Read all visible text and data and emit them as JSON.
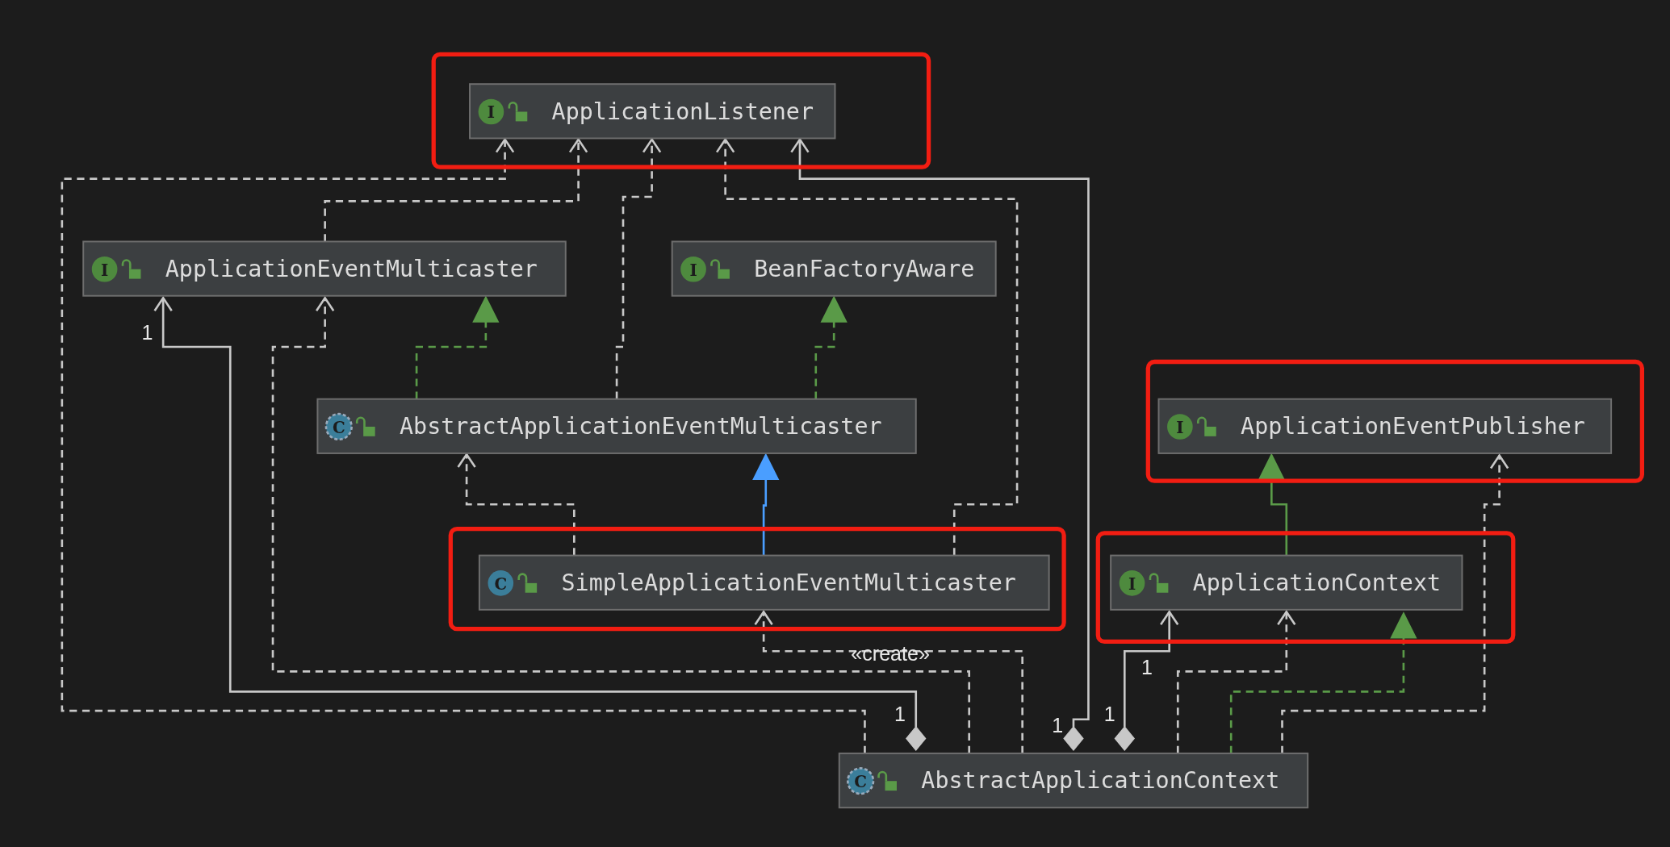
{
  "diagram": {
    "nodes": [
      {
        "name": "ApplicationListener",
        "kind": "interface",
        "badge": "I",
        "highlighted": true
      },
      {
        "name": "ApplicationEventMulticaster",
        "kind": "interface",
        "badge": "I",
        "highlighted": false
      },
      {
        "name": "BeanFactoryAware",
        "kind": "interface",
        "badge": "I",
        "highlighted": false
      },
      {
        "name": "AbstractApplicationEventMulticaster",
        "kind": "abstract",
        "badge": "C",
        "highlighted": false
      },
      {
        "name": "ApplicationEventPublisher",
        "kind": "interface",
        "badge": "I",
        "highlighted": true
      },
      {
        "name": "SimpleApplicationEventMulticaster",
        "kind": "class",
        "badge": "C",
        "highlighted": true
      },
      {
        "name": "ApplicationContext",
        "kind": "interface",
        "badge": "I",
        "highlighted": true
      },
      {
        "name": "AbstractApplicationContext",
        "kind": "abstract",
        "badge": "C",
        "highlighted": false
      }
    ],
    "edges": [
      {
        "kind": "dependency"
      },
      {
        "kind": "dependency"
      },
      {
        "kind": "dependency"
      },
      {
        "kind": "dependency"
      },
      {
        "kind": "composition",
        "labels": [
          "1"
        ]
      },
      {
        "kind": "realization"
      },
      {
        "kind": "realization"
      },
      {
        "kind": "generalization"
      },
      {
        "kind": "dependency"
      },
      {
        "kind": "composition",
        "labels": [
          "1",
          "1"
        ]
      },
      {
        "kind": "dependency"
      },
      {
        "kind": "dependency",
        "labels": [
          "«create»"
        ]
      },
      {
        "kind": "composition",
        "labels": [
          "1",
          "1"
        ]
      },
      {
        "kind": "dependency"
      },
      {
        "kind": "realization"
      },
      {
        "kind": "dependency"
      },
      {
        "kind": "extension"
      }
    ]
  }
}
